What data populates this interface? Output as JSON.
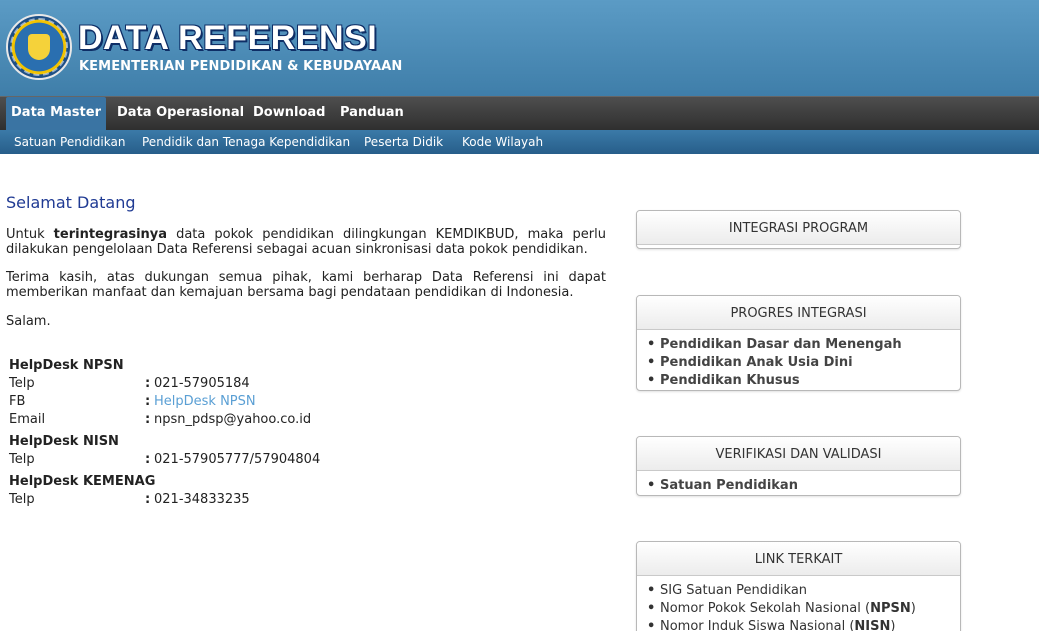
{
  "header": {
    "logo_icon": "tut-wuri-handayani-logo",
    "title": "DATA REFERENSI",
    "subtitle": "KEMENTERIAN PENDIDIKAN & KEBUDAYAAN"
  },
  "main_nav": {
    "items": [
      {
        "label": "Data Master",
        "active": true
      },
      {
        "label": "Data Operasional"
      },
      {
        "label": "Download"
      },
      {
        "label": "Panduan"
      }
    ]
  },
  "sub_nav": {
    "items": [
      {
        "label": "Satuan Pendidikan"
      },
      {
        "label": "Pendidik dan Tenaga Kependidikan"
      },
      {
        "label": "Peserta Didik"
      },
      {
        "label": "Kode Wilayah"
      }
    ]
  },
  "content": {
    "heading": "Selamat Datang",
    "intro_prefix": "Untuk ",
    "intro_bold": "terintegrasinya",
    "intro_suffix": " data pokok pendidikan dilingkungan KEMDIKBUD, maka perlu dilakukan pengelolaan Data Referensi sebagai acuan sinkronisasi data pokok pendidikan.",
    "thanks": "Terima kasih, atas dukungan semua pihak, kami berharap Data Referensi ini dapat memberikan manfaat dan kemajuan bersama bagi pendataan pendidikan di Indonesia.",
    "salam": "Salam."
  },
  "helpdesk": {
    "npsn": {
      "title": "HelpDesk NPSN",
      "telp_label": "Telp",
      "telp": "021-57905184",
      "fb_label": "FB",
      "fb": "HelpDesk NPSN",
      "email_label": "Email",
      "email": "npsn_pdsp@yahoo.co.id"
    },
    "nisn": {
      "title": "HelpDesk NISN",
      "telp_label": "Telp",
      "telp": "021-57905777/57904804"
    },
    "kemenag": {
      "title": "HelpDesk KEMENAG",
      "telp_label": "Telp",
      "telp": "021-34833235"
    },
    "colon": ":"
  },
  "panels": {
    "integrasi": {
      "title": "INTEGRASI PROGRAM"
    },
    "progres": {
      "title": "PROGRES INTEGRASI",
      "items": [
        "Pendidikan Dasar dan Menengah",
        "Pendidikan Anak Usia Dini",
        "Pendidikan Khusus"
      ]
    },
    "verifikasi": {
      "title": "VERIFIKASI DAN VALIDASI",
      "items": [
        "Satuan Pendidikan"
      ]
    },
    "link": {
      "title": "LINK TERKAIT",
      "items": [
        {
          "text": "SIG Satuan Pendidikan"
        },
        {
          "text": "Nomor Pokok Sekolah Nasional (",
          "bold": "NPSN",
          "end": ")"
        },
        {
          "text": "Nomor Induk Siswa Nasional (",
          "bold": "NISN",
          "end": ")"
        }
      ]
    }
  },
  "colors": {
    "header_blue": "#4a8ab6",
    "nav_dark": "#3a3a3a",
    "nav_active": "#3a74a3",
    "heading_blue": "#1f3a93",
    "link_blue": "#5a9fd4"
  }
}
